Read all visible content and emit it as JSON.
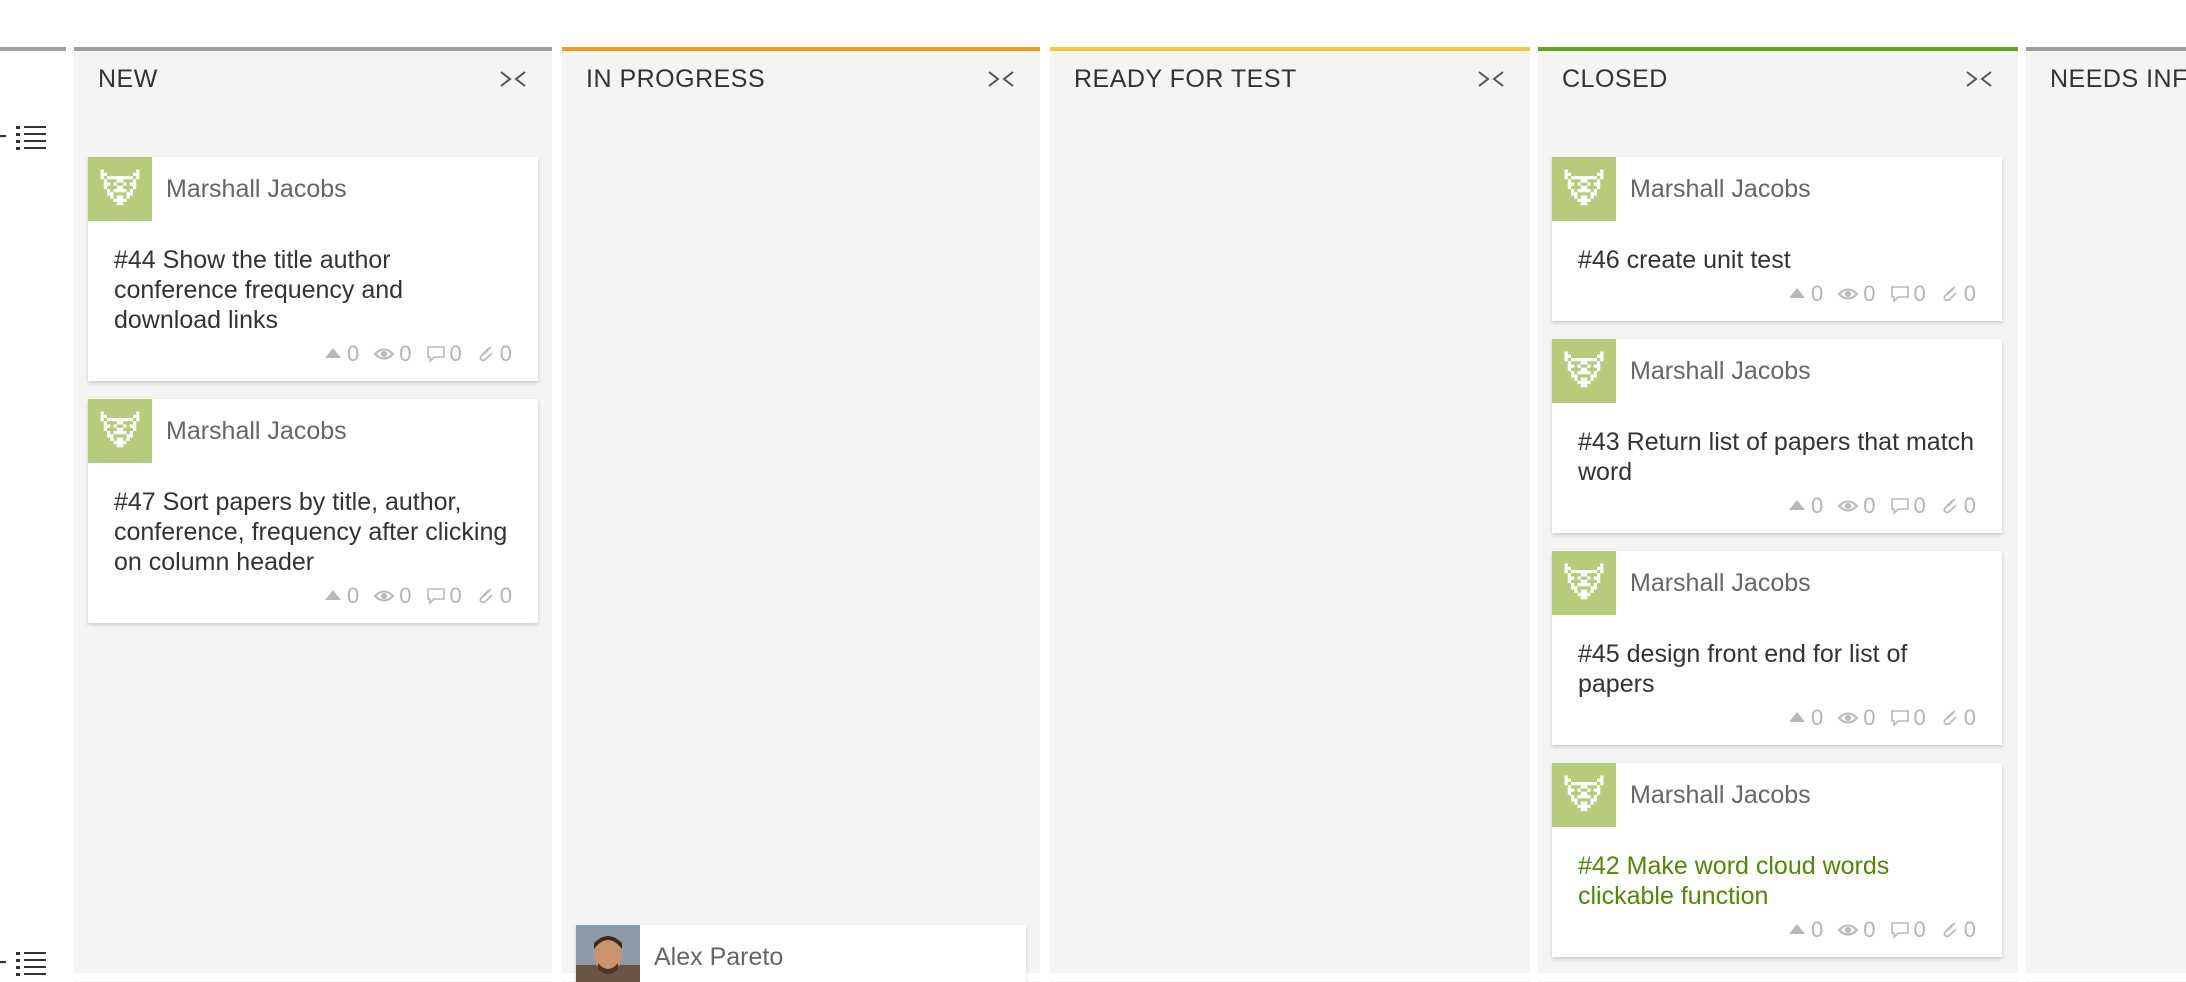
{
  "columns": [
    {
      "id": "new",
      "title": "NEW",
      "color": "#a0a0a0",
      "fold_icon": "fold-columns-icon"
    },
    {
      "id": "in-progress",
      "title": "IN PROGRESS",
      "color": "#f29a1f",
      "fold_icon": "fold-columns-icon"
    },
    {
      "id": "ready-for-test",
      "title": "READY FOR TEST",
      "color": "#f5c842",
      "fold_icon": "fold-columns-icon"
    },
    {
      "id": "closed",
      "title": "CLOSED",
      "color": "#6aa221",
      "fold_icon": "fold-columns-icon"
    },
    {
      "id": "needs-info",
      "title": "NEEDS INFO",
      "color": "#a0a0a0"
    }
  ],
  "lane_tools": {
    "add_icon": "plus-icon",
    "list_icon": "list-icon"
  },
  "cards": {
    "new": [
      {
        "author": "Marshall Jacobs",
        "title": "#44 Show the title author conference frequency and download links",
        "votes": "0",
        "watchers": "0",
        "comments": "0",
        "attachments": "0"
      },
      {
        "author": "Marshall Jacobs",
        "title": "#47 Sort papers by title, author, conference, frequency after clicking on column header",
        "votes": "0",
        "watchers": "0",
        "comments": "0",
        "attachments": "0"
      }
    ],
    "closed": [
      {
        "author": "Marshall Jacobs",
        "title": "#46 create unit test",
        "votes": "0",
        "watchers": "0",
        "comments": "0",
        "attachments": "0"
      },
      {
        "author": "Marshall Jacobs",
        "title": "#43 Return list of papers that match word",
        "votes": "0",
        "watchers": "0",
        "comments": "0",
        "attachments": "0"
      },
      {
        "author": "Marshall Jacobs",
        "title": "#45 design front end for list of papers",
        "votes": "0",
        "watchers": "0",
        "comments": "0",
        "attachments": "0"
      },
      {
        "author": "Marshall Jacobs",
        "title": "#42 Make word cloud words clickable function",
        "votes": "0",
        "watchers": "0",
        "comments": "0",
        "attachments": "0",
        "highlight_color": "#4e8a00"
      }
    ],
    "in_progress_lane2": [
      {
        "author": "Alex Pareto"
      }
    ]
  }
}
